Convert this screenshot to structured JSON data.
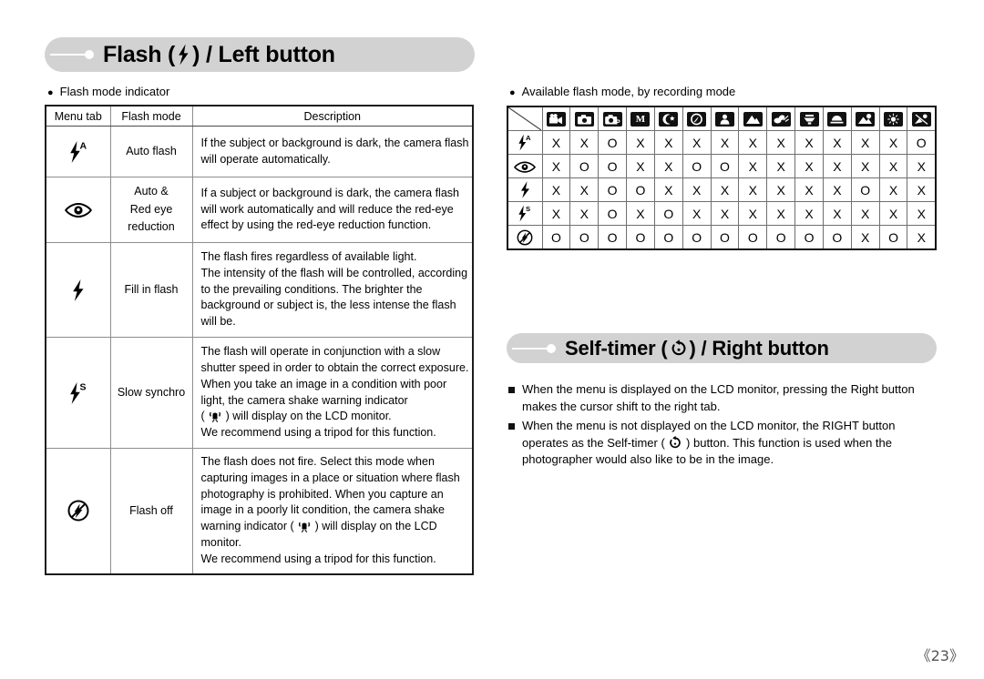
{
  "sections": {
    "flash": {
      "title_prefix": "Flash (",
      "title_suffix": ") / Left button",
      "icon": "flash-bolt-icon",
      "bullet_label": "Flash mode indicator"
    },
    "selftimer": {
      "title_prefix": "Self-timer (",
      "title_suffix": ") / Right button",
      "icon": "self-timer-icon"
    },
    "matrix_bullet": "Available flash mode, by recording mode"
  },
  "flash_table": {
    "headers": [
      "Menu tab",
      "Flash mode",
      "Description"
    ],
    "rows": [
      {
        "icon": "auto-flash-icon",
        "mode": [
          "Auto flash"
        ],
        "description": [
          "If the subject or background is dark, the camera flash",
          "will operate automatically."
        ]
      },
      {
        "icon": "red-eye-reduction-icon",
        "mode": [
          "Auto &",
          "Red eye",
          "reduction"
        ],
        "description": [
          "If a subject or background is dark, the camera flash",
          "will work automatically and will reduce the red-eye",
          "effect by using the red-eye reduction function."
        ]
      },
      {
        "icon": "fill-in-flash-icon",
        "mode": [
          "Fill in flash"
        ],
        "description": [
          "The flash fires regardless of available light.",
          "The intensity of the flash will be controlled, according",
          "to the prevailing conditions. The brighter the",
          "background or subject is, the less intense the flash",
          "will be."
        ]
      },
      {
        "icon": "slow-synchro-icon",
        "mode": [
          "Slow synchro"
        ],
        "description": [
          "The flash will operate in conjunction with a slow",
          "shutter speed in order to obtain the correct exposure.",
          "When you take an image in a condition with poor",
          "light, the camera shake warning indicator",
          "(  ) will display on the LCD monitor.",
          "We recommend using a tripod for this function."
        ],
        "shake_icon_line": 4
      },
      {
        "icon": "flash-off-icon",
        "mode": [
          "Flash off"
        ],
        "description": [
          "The flash does not fire. Select this mode when",
          "capturing images in a place or situation where flash",
          "photography is prohibited. When you capture an",
          "image in a poorly lit condition, the camera shake",
          "warning indicator (  ) will display on the LCD",
          "monitor.",
          "We recommend using a tripod for this function."
        ],
        "shake_icon_line": 4
      }
    ]
  },
  "matrix": {
    "column_icons": [
      "movie-mode-icon",
      "auto-mode-icon",
      "program-mode-icon",
      "manual-mode-icon",
      "night-scene-mode-icon",
      "portrait-mode-icon",
      "children-mode-icon",
      "landscape-mode-icon",
      "close-up-mode-icon",
      "text-mode-icon",
      "sunset-mode-icon",
      "dawn-mode-icon",
      "backlight-mode-icon",
      "fireworks-mode-icon"
    ],
    "row_icons": [
      "auto-flash-icon",
      "red-eye-reduction-icon",
      "fill-in-flash-icon",
      "slow-synchro-icon",
      "flash-off-icon"
    ],
    "values": [
      [
        "X",
        "X",
        "O",
        "X",
        "X",
        "X",
        "X",
        "X",
        "X",
        "X",
        "X",
        "X",
        "X",
        "O"
      ],
      [
        "X",
        "O",
        "O",
        "X",
        "X",
        "O",
        "O",
        "X",
        "X",
        "X",
        "X",
        "X",
        "X",
        "X"
      ],
      [
        "X",
        "X",
        "O",
        "O",
        "X",
        "X",
        "X",
        "X",
        "X",
        "X",
        "X",
        "O",
        "X",
        "X"
      ],
      [
        "X",
        "X",
        "O",
        "X",
        "O",
        "X",
        "X",
        "X",
        "X",
        "X",
        "X",
        "X",
        "X",
        "X"
      ],
      [
        "O",
        "O",
        "O",
        "O",
        "O",
        "O",
        "O",
        "O",
        "O",
        "O",
        "O",
        "X",
        "O",
        "X"
      ]
    ]
  },
  "selftimer_notes": [
    [
      "When the menu is displayed on the LCD monitor, pressing the Right button",
      "makes the cursor shift to the right tab."
    ],
    [
      "When the menu is not displayed on the LCD monitor, the RIGHT button",
      "operates as the Self-timer (  ) button. This function is used when the",
      "photographer would also like to be in the image."
    ]
  ],
  "page_number": "《23》",
  "colors": {
    "pill": "#d2d2d2",
    "text": "#000000",
    "table_border": "#111111",
    "grid": "#6f6f6f"
  }
}
